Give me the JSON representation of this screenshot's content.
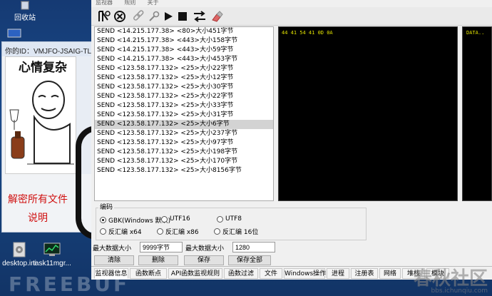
{
  "desktop": {
    "recycle_bin_label": "回收站",
    "icons": [
      {
        "label": "desktop.ini"
      },
      {
        "label": "task11mgr..."
      }
    ]
  },
  "ransom_window": {
    "title": "你的ID：VMJFO-JSAIG-TLZXU",
    "meme_caption": "心情复杂",
    "line1": "解密所有文件",
    "line2": "说明"
  },
  "monitor": {
    "menu": [
      "监视器",
      "规则",
      "关于"
    ],
    "toolbar": [
      {
        "icon": "filter-icon"
      },
      {
        "icon": "stop-circle-icon"
      },
      {
        "icon": "link-icon"
      },
      {
        "icon": "tool-icon"
      },
      {
        "icon": "play-icon"
      },
      {
        "icon": "stop-icon"
      },
      {
        "icon": "swap-arrows-icon"
      },
      {
        "icon": "eraser-icon"
      }
    ],
    "packets": [
      {
        "text": "SEND <14.215.177.38> <80>大小451字节"
      },
      {
        "text": "SEND <14.215.177.38> <443>大小158字节"
      },
      {
        "text": "SEND <14.215.177.38> <443>大小59字节"
      },
      {
        "text": "SEND <14.215.177.38> <443>大小453字节"
      },
      {
        "text": "SEND <123.58.177.132> <25>大小22字节"
      },
      {
        "text": "SEND <123.58.177.132> <25>大小12字节"
      },
      {
        "text": "SEND <123.58.177.132> <25>大小30字节"
      },
      {
        "text": "SEND <123.58.177.132> <25>大小22字节"
      },
      {
        "text": "SEND <123.58.177.132> <25>大小33字节"
      },
      {
        "text": "SEND <123.58.177.132> <25>大小31字节"
      },
      {
        "text": "SEND <123.58.177.132> <25>大小6字节"
      },
      {
        "text": "SEND <123.58.177.132> <25>大小237字节"
      },
      {
        "text": "SEND <123.58.177.132> <25>大小97字节"
      },
      {
        "text": "SEND <123.58.177.132> <25>大小198字节"
      },
      {
        "text": "SEND <123.58.177.132> <25>大小170字节"
      },
      {
        "text": "SEND <123.58.177.132> <25>大小8156字节"
      }
    ],
    "selected_index": 10,
    "hex_dump": "44 41 54 41 0D 0A",
    "ascii_dump": "DATA..",
    "encoding": {
      "label": "编码",
      "options": [
        {
          "label": "GBK(Windows 默认)",
          "checked": true
        },
        {
          "label": "UTF16",
          "checked": false
        },
        {
          "label": "UTF8",
          "checked": false
        },
        {
          "label": "反汇编 x64",
          "checked": false
        },
        {
          "label": "反汇编 x86",
          "checked": false
        },
        {
          "label": "反汇编 16位",
          "checked": false
        }
      ]
    },
    "max_data_label_1": "最大数据大小",
    "max_data_value_1": "9999字节",
    "max_data_label_2": "最大数据大小",
    "max_data_value_2": "1280",
    "buttons": {
      "clear": "清除",
      "delete": "删除",
      "save": "保存",
      "save_all": "保存全部"
    },
    "tabs": [
      "监视器信息",
      "函数断点",
      "API函数监视规则",
      "函数过滤",
      "文件",
      "Windows操作",
      "进程",
      "注册表",
      "网络",
      "堆栈",
      "模块"
    ],
    "active_tab": 0
  },
  "watermarks": {
    "left": "FREEBUF",
    "right_big": "春秋社区",
    "right_small": "bbs.ichunqiu.com"
  },
  "colors": {
    "hex_text": "#e0e000",
    "ransom_red": "#d01010",
    "selected_row": "#d3d3d3"
  }
}
